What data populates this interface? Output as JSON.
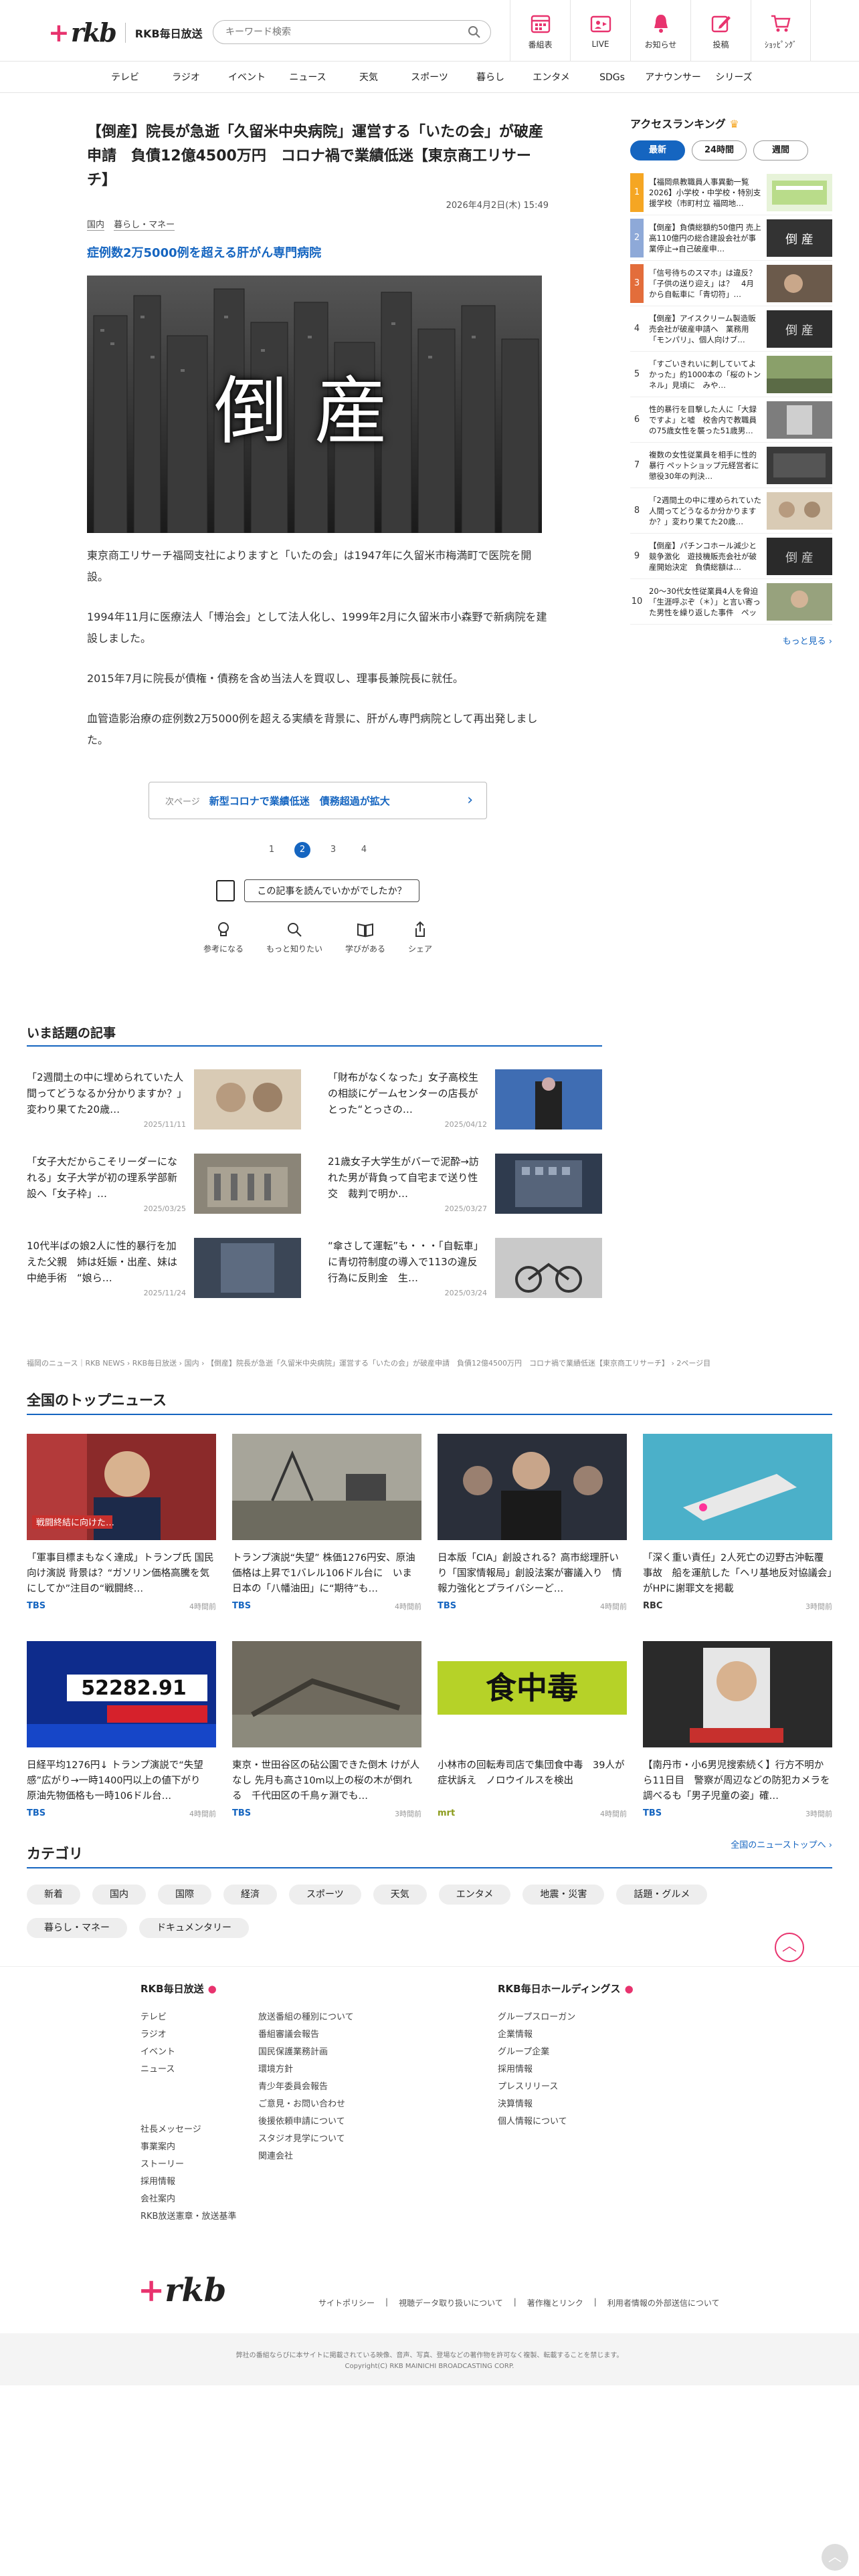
{
  "header": {
    "logo_text": "rkb",
    "site_name": "RKB毎日放送",
    "search_placeholder": "キーワード検索",
    "nav": [
      {
        "label": "番組表",
        "icon": "calendar-icon"
      },
      {
        "label": "LIVE",
        "icon": "live-icon"
      },
      {
        "label": "お知らせ",
        "icon": "bell-icon"
      },
      {
        "label": "投稿",
        "icon": "pen-icon"
      },
      {
        "label": "ｼｮｯﾋﾟﾝｸﾞ",
        "icon": "cart-icon"
      }
    ],
    "accent": "#e8336e"
  },
  "categories_nav": [
    "テレビ",
    "ラジオ",
    "イベント",
    "ニュース",
    "天気",
    "スポーツ",
    "暮らし",
    "エンタメ",
    "SDGs",
    "アナウンサー",
    "シリーズ"
  ],
  "article": {
    "title": "【倒産】院長が急逝「久留米中央病院」運営する「いたの会」が破産申請　負債12億4500万円　コロナ禍で業績低迷【東京商工リサーチ】",
    "datetime": "2026年4月2日(木) 15:49",
    "tags": [
      "国内",
      "暮らし・マネー"
    ],
    "subtitle": "症例数2万5000例を超える肝がん専門病院",
    "hero_text": "倒産",
    "paragraphs": [
      "東京商工リサーチ福岡支社によりますと「いたの会」は1947年に久留米市梅満町で医院を開設。",
      "1994年11月に医療法人「博治会」として法人化し、1999年2月に久留米市小森野で新病院を建設しました。",
      "2015年7月に院長が債権・債務を含め当法人を買収し、理事長兼院長に就任。",
      "血管造影治療の症例数2万5000例を超える実績を背景に、肝がん専門病院として再出発しました。"
    ],
    "next_label": "次ページ",
    "next_title": "新型コロナで業績低迷　債務超過が拡大",
    "pages": [
      "1",
      "2",
      "3",
      "4"
    ],
    "current_page": "2",
    "feedback_question": "この記事を読んでいかがでしたか？",
    "feedback_buttons": [
      {
        "label": "参考になる",
        "icon": "lightbulb-icon"
      },
      {
        "label": "もっと知りたい",
        "icon": "magnifier-icon"
      },
      {
        "label": "学びがある",
        "icon": "book-icon"
      },
      {
        "label": "シェア",
        "icon": "share-icon"
      }
    ],
    "accent": "#1565c0"
  },
  "ranking": {
    "title": "アクセスランキング",
    "tabs": [
      "最新",
      "24時間",
      "週間"
    ],
    "active_tab": "最新",
    "items": [
      "【福岡県教職員人事異動一覧2026】小学校・中学校・特別支援学校（市町村立 福岡地…",
      "【倒産】負債総額約50億円 売上高110億円の総合建設会社が事業停止→自己破産申…",
      "「信号待ちのスマホ」は違反？「子供の送り迎え」は？　4月から自転車に「青切符」…",
      "【倒産】アイスクリーム製造販売会社が破産申請へ　業務用「モンパリ」、個人向けブ…",
      "「すごいきれいに刺していてよかった」約1000本の「桜のトンネル」見頃に　みや…",
      "性的暴行を目撃した人に「大録ですよ」と嘘　校舎内で教職員の75歳女性を襲った51歳男…",
      "複数の女性従業員を相手に性的暴行 ペットショップ元経営者に懲役30年の判決…",
      "「2週間土の中に埋められていた人間ってどうなるか分かりますか？」変わり果てた20歳…",
      "【倒産】パチンコホール減少と競争激化　遊技機販売会社が破産開始決定　負債総額は…",
      "20～30代女性従業員4人を脅迫「生涯呼ぶぞ（＊）」と言い寄った男性を繰り返した事件　ペット…"
    ],
    "more": "もっと見る"
  },
  "popular": {
    "title": "いま話題の記事",
    "items": [
      {
        "title": "「2週間土の中に埋められていた人間ってどうなるか分かりますか？」変わり果てた20歳…",
        "date": "2025/11/11"
      },
      {
        "title": "「財布がなくなった」女子高校生の相談にゲームセンターの店長がとった“とっさの…",
        "date": "2025/04/12"
      },
      {
        "title": "「女子大だからこそリーダーになれる」女子大学が初の理系学部新設へ「女子枠」…",
        "date": "2025/03/25"
      },
      {
        "title": "21歳女子大学生がバーで泥酔→訪れた男が背負って自宅まで送り性交　裁判で明か…",
        "date": "2025/03/27"
      },
      {
        "title": "10代半ばの娘2人に性的暴行を加えた父親　姉は妊娠・出産、妹は中絶手術　“娘ら…",
        "date": "2025/11/24"
      },
      {
        "title": "“傘さして運転”も・・・「自転車」に青切符制度の導入で113の違反行為に反則金　生…",
        "date": "2025/03/24"
      }
    ]
  },
  "breadcrumb": "福岡のニュース｜RKB NEWS › RKB毎日放送 › 国内 › 【倒産】院長が急逝「久留米中央病院」運営する「いたの会」が破産申請　負債12億4500万円　コロナ禍で業績低迷【東京商工リサーチ】 › 2ページ目",
  "national": {
    "title": "全国のトップニュース",
    "items": [
      {
        "title": "「軍事目標まもなく達成」トランプ氏 国民向け演説 背景は？“ガソリン価格高騰を気にしてか”注目の“戦闘終…",
        "src": "TBS",
        "time": "4時間前",
        "thumb_text": "戦闘終結に向けた…"
      },
      {
        "title": "トランプ演説“失望” 株価1276円安、原油価格は上昇で1バレル106ドル台に　いま日本の「八幡油田」に“期待”も…",
        "src": "TBS",
        "time": "4時間前",
        "thumb_text": ""
      },
      {
        "title": "日本版「CIA」創設される？高市総理肝いり「国家情報局」創設法案が審議入り　情報力強化とプライバシーど…",
        "src": "TBS",
        "time": "4時間前",
        "thumb_text": ""
      },
      {
        "title": "「深く重い責任」2人死亡の辺野古沖転覆事故　船を運航した「ヘリ基地反対協議会」がHPに謝罪文を掲載",
        "src": "RBC",
        "time": "3時間前",
        "thumb_text": ""
      },
      {
        "title": "日経平均1276円↓ トランプ演説で“失望感”広がり→一時1400円以上の値下がり　原油先物価格も一時106ドル台…",
        "src": "TBS",
        "time": "4時間前",
        "thumb_text": "52282.91"
      },
      {
        "title": "東京・世田谷区の砧公園できた倒木 けが人なし 先月も高さ10m以上の桜の木が倒れる　千代田区の千鳥ヶ淵でも…",
        "src": "TBS",
        "time": "3時間前",
        "thumb_text": ""
      },
      {
        "title": "小林市の回転寿司店で集団食中毒　39人が症状訴え　ノロウイルスを検出",
        "src": "mrt",
        "time": "4時間前",
        "thumb_text": "食中毒"
      },
      {
        "title": "【南丹市・小6男児搜索続く】行方不明から11日目　警察が周辺などの防犯カメラを調べるも「男子児童の姿」確…",
        "src": "TBS",
        "time": "3時間前",
        "thumb_text": ""
      }
    ],
    "more": "全国のニューストップへ"
  },
  "category": {
    "title": "カテゴリ",
    "chips": [
      "新着",
      "国内",
      "国際",
      "経済",
      "スポーツ",
      "天気",
      "エンタメ",
      "地震・災害",
      "話題・グルメ",
      "暮らし・マネー",
      "ドキュメンタリー"
    ]
  },
  "footer": {
    "col1_title": "RKB毎日放送",
    "col1a": [
      "テレビ",
      "ラジオ",
      "イベント",
      "ニュース"
    ],
    "col1b": [
      "社長メッセージ",
      "事業案内",
      "ストーリー",
      "採用情報",
      "会社案内",
      "RKB放送憲章・放送基準"
    ],
    "col2": [
      "放送番組の種別について",
      "番組審議会報告",
      "国民保護業務計画",
      "環境方針",
      "青少年委員会報告",
      "ご意見・お問い合わせ",
      "後援依頼申請について",
      "スタジオ見学について",
      "関連会社"
    ],
    "col3_title": "RKB毎日ホールディングス",
    "col3": [
      "グループスローガン",
      "企業情報",
      "グループ企業",
      "採用情報",
      "プレスリリース",
      "決算情報",
      "個人情報について"
    ],
    "logo_text": "rkb",
    "links": [
      "サイトポリシー",
      "|",
      "視聴データ取り扱いについて",
      "|",
      "著作権とリンク",
      "|",
      "利用者情報の外部送信について"
    ],
    "notice": "弊社の番組ならびに本サイトに掲載されている映像、音声、写真、登場などの著作物を許可なく複製、転載することを禁じます。",
    "copyright": "Copyright(C) RKB MAINICHI BROADCASTING CORP."
  }
}
